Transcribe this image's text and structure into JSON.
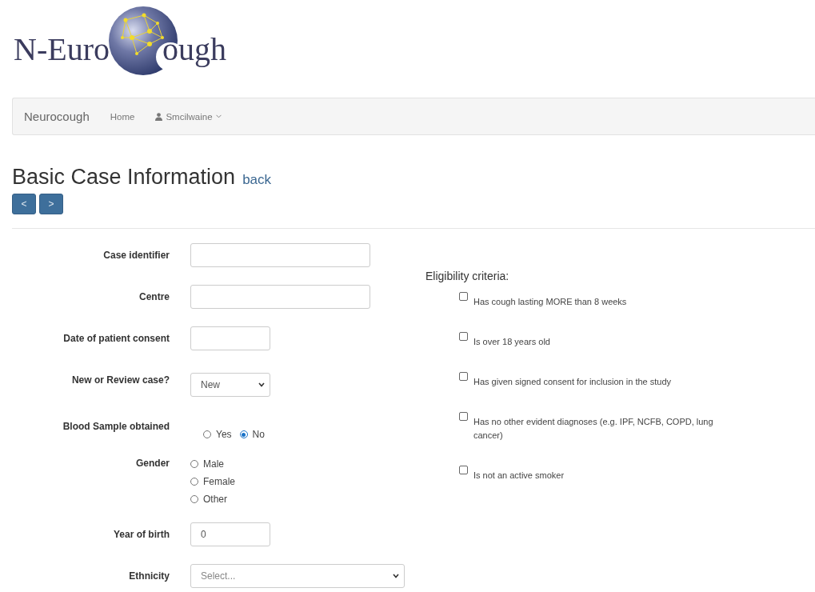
{
  "logo": {
    "text_before": "N-Euro",
    "text_after": "ough"
  },
  "navbar": {
    "brand": "Neurocough",
    "links": [
      {
        "label": "Home",
        "kind": "link"
      },
      {
        "label": "Smcilwaine",
        "kind": "user-menu"
      }
    ]
  },
  "page": {
    "title": "Basic Case Information",
    "back_link": "back",
    "pager": [
      "<",
      ">"
    ]
  },
  "form": {
    "fields": [
      {
        "label": "Case identifier",
        "kind": "text"
      },
      {
        "label": "Centre",
        "kind": "text"
      },
      {
        "label": "Date of patient consent",
        "kind": "short-text"
      },
      {
        "label": "New or Review case?",
        "kind": "select",
        "value": "New"
      },
      {
        "label": "Blood Sample obtained",
        "kind": "radio-inline",
        "options": [
          {
            "label": "Yes",
            "selected": false
          },
          {
            "label": "No",
            "selected": true
          }
        ]
      },
      {
        "label": "Gender",
        "kind": "radio-stack",
        "options": [
          {
            "label": "Male",
            "selected": false
          },
          {
            "label": "Female",
            "selected": false
          },
          {
            "label": "Other",
            "selected": false
          }
        ]
      },
      {
        "label": "Year of birth",
        "kind": "short-text",
        "value": "0"
      },
      {
        "label": "Ethnicity",
        "kind": "wide-select",
        "value": "Select..."
      }
    ]
  },
  "eligibility": {
    "title": "Eligibility criteria:",
    "criteria": [
      {
        "label": "Has cough lasting MORE than 8 weeks",
        "checked": false
      },
      {
        "label": "Is over 18 years old",
        "checked": false
      },
      {
        "label": "Has given signed consent for inclusion in the study",
        "checked": false
      },
      {
        "label": "Has no other evident diagnoses (e.g. IPF, NCFB, COPD, lung cancer)",
        "checked": false
      },
      {
        "label": "Is not an active smoker",
        "checked": false
      }
    ]
  }
}
